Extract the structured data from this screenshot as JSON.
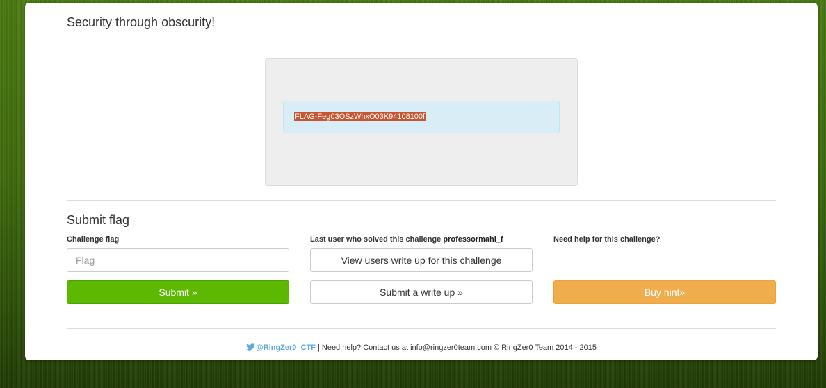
{
  "challenge": {
    "title": "Security through obscurity!",
    "flag_text": "FLAG-Feg03OSzWhxO03K94108100f"
  },
  "submit_section": {
    "title": "Submit flag",
    "flag_label": "Challenge flag",
    "flag_placeholder": "Flag",
    "submit_label": "Submit »",
    "last_user_label": "Last user who solved this challenge",
    "last_user_name": "professormahi_f",
    "view_writeups_label": "View users write up for this challenge",
    "submit_writeup_label": "Submit a write up »",
    "help_label": "Need help for this challenge?",
    "buy_hint_label": "Buy hint»"
  },
  "footer": {
    "twitter_handle": "@RingZer0_CTF",
    "text": " | Need help? Contact us at info@ringzer0team.com © RingZer0 Team 2014 - 2015",
    "twitter_icon": "twitter-bird-icon"
  },
  "colors": {
    "submit_green": "#5cb800",
    "hint_orange": "#f0ad4e",
    "flag_highlight": "#c8552f",
    "flag_box_blue": "#d9edf7",
    "twitter_blue": "#5aa9e0"
  }
}
